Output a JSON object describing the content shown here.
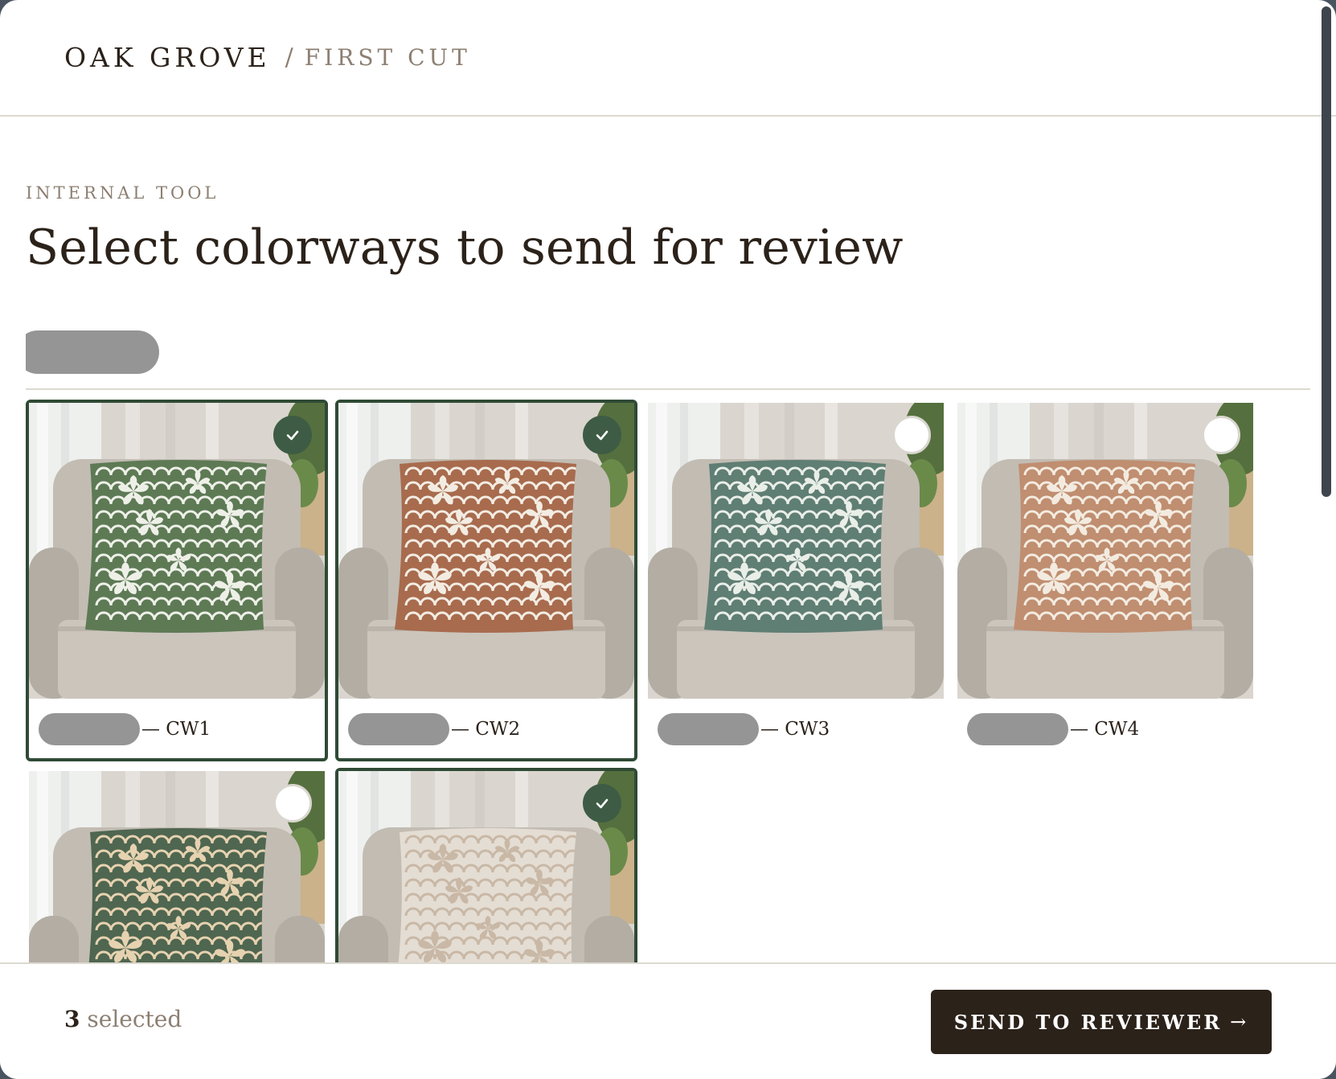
{
  "header": {
    "brand": "OAK GROVE",
    "separator": "/",
    "section": "FIRST CUT"
  },
  "page": {
    "eyebrow": "INTERNAL TOOL",
    "title": "Select colorways to send for review"
  },
  "colorways": [
    {
      "code": "— CW1",
      "selected": true,
      "pillow": "#5d7a55",
      "pattern": "#eef0e8"
    },
    {
      "code": "— CW2",
      "selected": true,
      "pillow": "#a86b4e",
      "pattern": "#f3ece2"
    },
    {
      "code": "— CW3",
      "selected": false,
      "pillow": "#5f7e74",
      "pattern": "#e9eee8"
    },
    {
      "code": "— CW4",
      "selected": false,
      "pillow": "#c08e70",
      "pattern": "#f3ebe0"
    },
    {
      "code": "",
      "selected": false,
      "pillow": "#4f6650",
      "pattern": "#e6d2b0"
    },
    {
      "code": "",
      "selected": true,
      "pillow": "#e4ddd3",
      "pattern": "#c9b8a6"
    }
  ],
  "footer": {
    "count": "3",
    "count_label": "selected",
    "send_label": "SEND TO REVIEWER",
    "send_arrow": "→"
  },
  "colors": {
    "accent": "#2f4a35",
    "dark": "#2b221a",
    "muted": "#8c7f72"
  }
}
